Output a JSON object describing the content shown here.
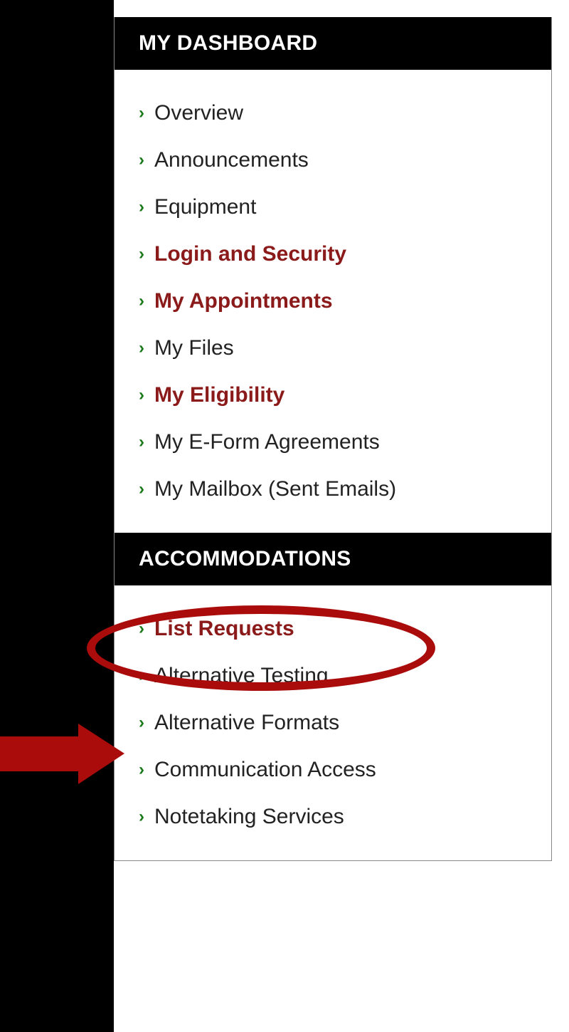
{
  "sections": [
    {
      "header": "MY DASHBOARD",
      "items": [
        {
          "label": "Overview",
          "highlighted": false
        },
        {
          "label": "Announcements",
          "highlighted": false
        },
        {
          "label": "Equipment",
          "highlighted": false
        },
        {
          "label": "Login and Security",
          "highlighted": true
        },
        {
          "label": "My Appointments",
          "highlighted": true
        },
        {
          "label": "My Files",
          "highlighted": false
        },
        {
          "label": "My Eligibility",
          "highlighted": true
        },
        {
          "label": "My E-Form Agreements",
          "highlighted": false
        },
        {
          "label": "My Mailbox (Sent Emails)",
          "highlighted": false
        }
      ]
    },
    {
      "header": "ACCOMMODATIONS",
      "items": [
        {
          "label": "List Requests",
          "highlighted": true
        },
        {
          "label": "Alternative Testing",
          "highlighted": false
        },
        {
          "label": "Alternative Formats",
          "highlighted": false
        },
        {
          "label": "Communication Access",
          "highlighted": false
        },
        {
          "label": "Notetaking Services",
          "highlighted": false
        }
      ]
    }
  ],
  "colors": {
    "accent_green": "#1a7a1a",
    "highlight_red": "#8b1a1a",
    "annotation_red": "#aa0c0c"
  }
}
